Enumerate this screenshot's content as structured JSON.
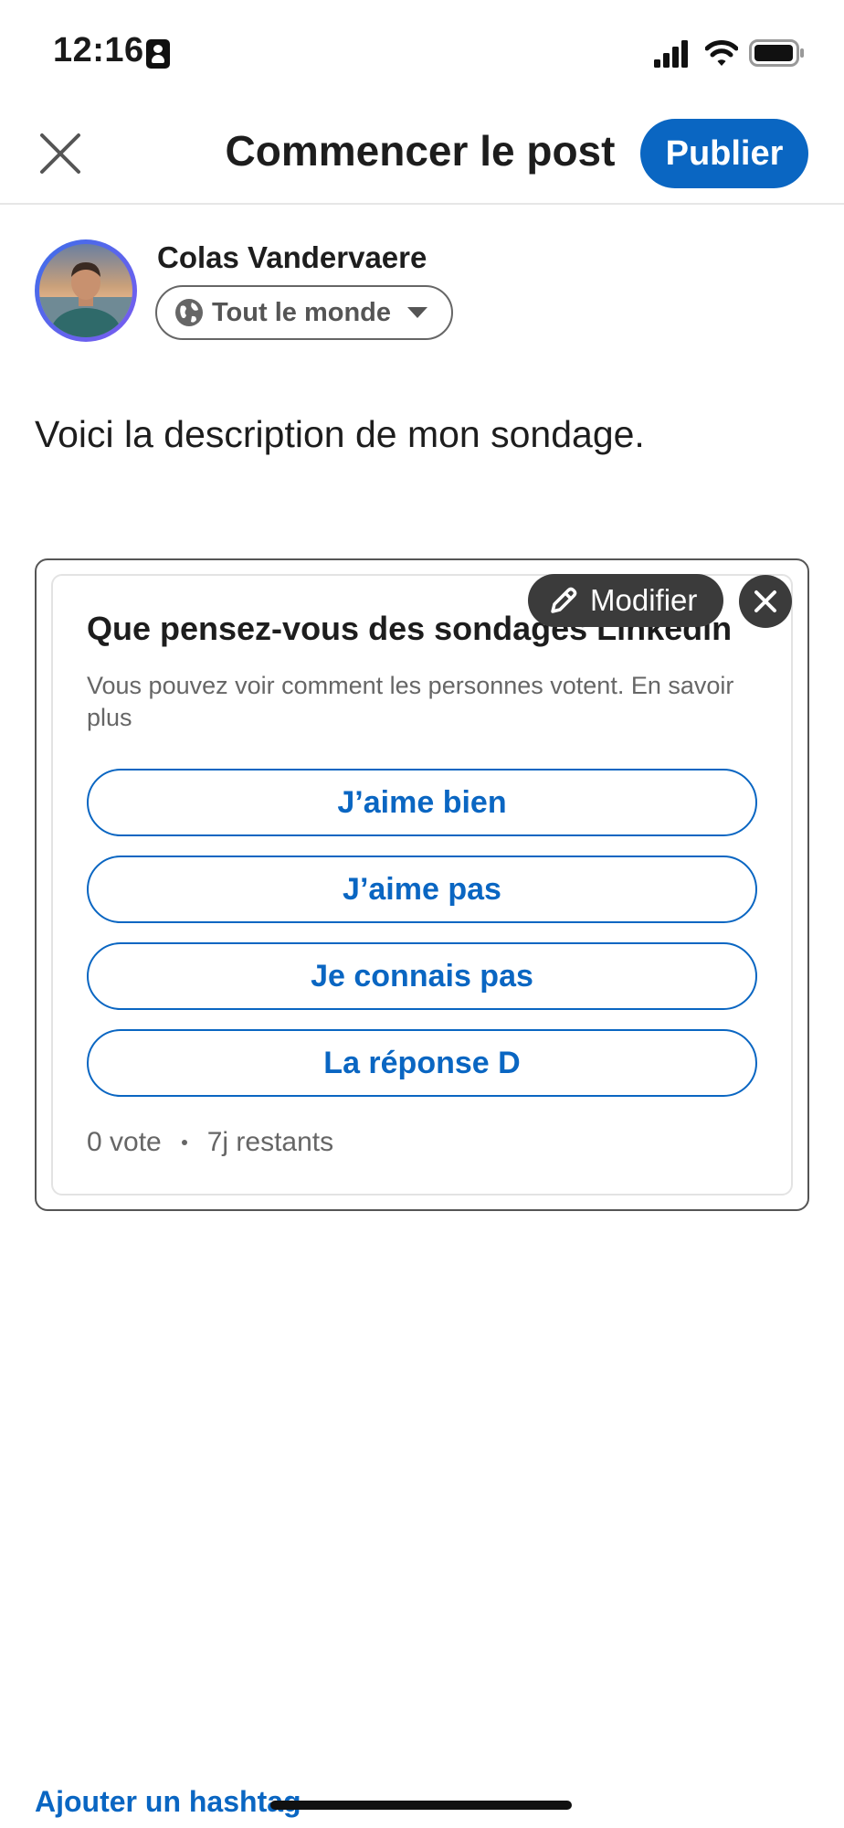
{
  "status_bar": {
    "time": "12:16",
    "icons": [
      "contact-card-icon",
      "cellular-signal-icon",
      "wifi-icon",
      "battery-icon"
    ]
  },
  "header": {
    "title": "Commencer le post",
    "publish_label": "Publier",
    "close_icon": "close-icon"
  },
  "author": {
    "name": "Colas Vandervaere",
    "visibility": "Tout le monde",
    "visibility_icon": "globe-icon"
  },
  "post": {
    "text": "Voici la description de mon sondage."
  },
  "poll": {
    "question": "Que pensez-vous des sondages Linkedin",
    "subtitle": "Vous pouvez voir comment les personnes votent. En savoir plus",
    "options": [
      "J’aime bien",
      "J’aime pas",
      "Je connais pas",
      "La réponse D"
    ],
    "votes": "0 vote",
    "remaining": "7j restants",
    "edit_label": "Modifier"
  },
  "footer": {
    "hashtag_label": "Ajouter un hashtag"
  },
  "colors": {
    "accent": "#0a66c2",
    "dark_overlay": "#3b3b3b"
  }
}
